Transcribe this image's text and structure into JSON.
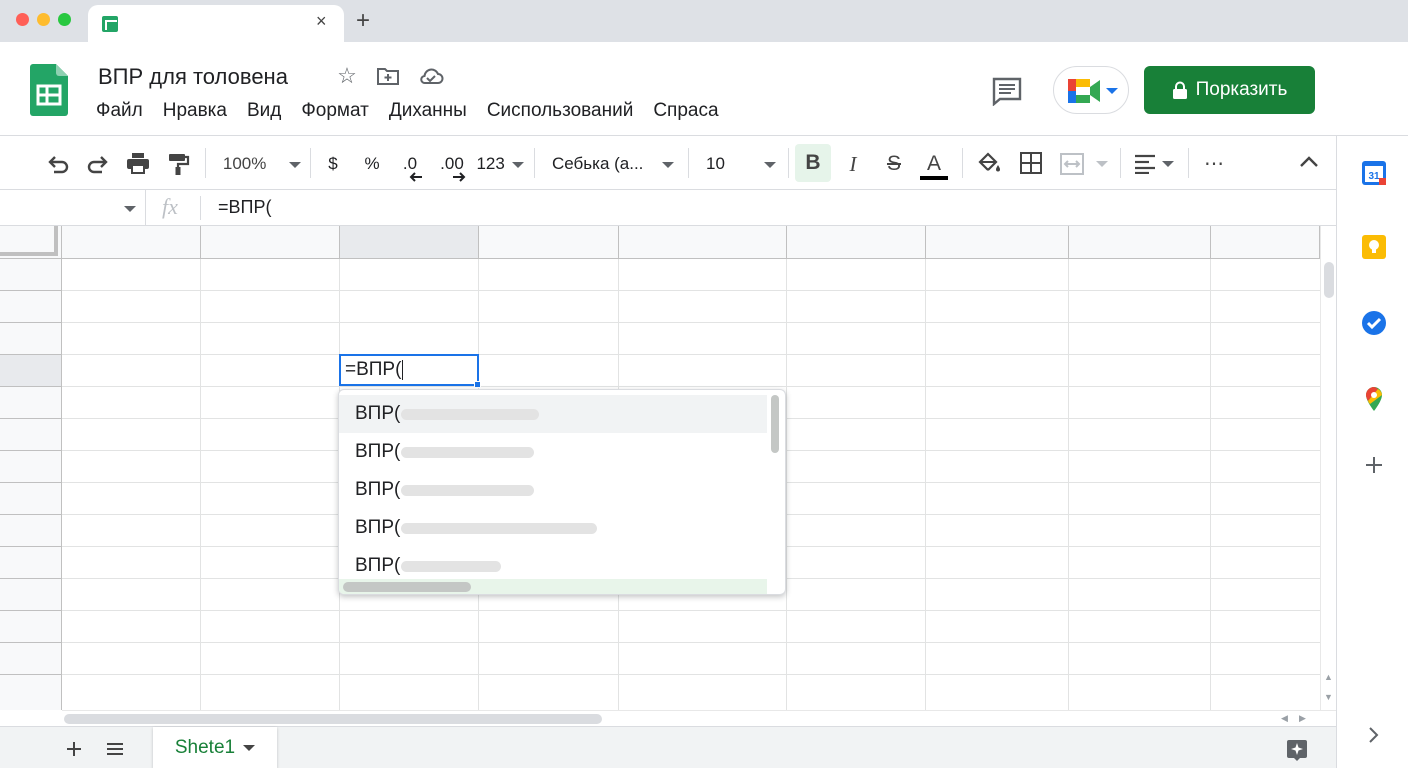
{
  "browser": {
    "new_tab_symbol": "+",
    "close_symbol": "×"
  },
  "header": {
    "title": "ВПР для толовена",
    "menu": [
      "Файл",
      "Нравка",
      "Вид",
      "Формат",
      "Диханны",
      "Сиспользований",
      "Спраса"
    ],
    "share_label": "Порказить"
  },
  "toolbar": {
    "zoom": "100%",
    "currency": "$",
    "percent": "%",
    "dec_decrease": ".0",
    "dec_increase": ".00",
    "number_format": "123",
    "font": "Себька (а...",
    "font_size": "10",
    "bold": "B",
    "italic": "I",
    "strike": "S",
    "text_color": "A",
    "more": "⋯"
  },
  "formula_bar": {
    "fx": "fx",
    "content": "=ВПР("
  },
  "cell": {
    "value": "=ВПР("
  },
  "suggestions": [
    {
      "label": "ВПР("
    },
    {
      "label": "ВПР("
    },
    {
      "label": "ВПР("
    },
    {
      "label": "ВПР("
    },
    {
      "label": "ВПР("
    }
  ],
  "sheets": [
    {
      "name": "Shete1"
    }
  ],
  "colors": {
    "accent": "#1a73e8",
    "brand_green": "#188038"
  }
}
